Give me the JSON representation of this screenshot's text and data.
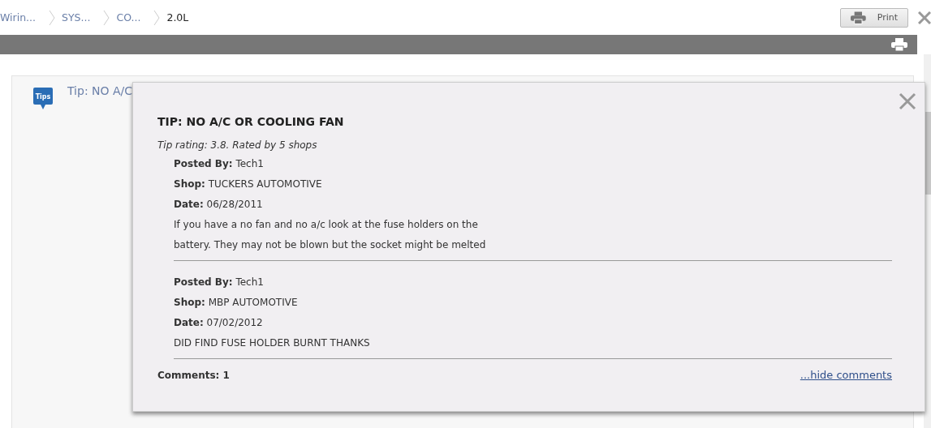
{
  "breadcrumbs": [
    {
      "label": "Wirin...",
      "current": false
    },
    {
      "label": "SYS...",
      "current": false
    },
    {
      "label": "CO...",
      "current": false
    },
    {
      "label": "2.0L",
      "current": true
    }
  ],
  "print_button": {
    "label": "Print"
  },
  "tip_card": {
    "badge": "Tips",
    "link": "Tip: NO A/C"
  },
  "popup": {
    "title": "TIP: NO A/C OR COOLING FAN",
    "rating": "Tip rating: 3.8. Rated by 5 shops",
    "posts": [
      {
        "posted_by": "**Posted By:** Tech1",
        "shop": "**Shop:** TUCKERS AUTOMOTIVE",
        "date": "**Date:** 06/28/2011",
        "text": "If you have a no fan and no a/c look at the fuse holders on the battery. They may not be blown but the socket might be melted"
      },
      {
        "posted_by": "**Posted By:** Tech1",
        "shop": "**Shop:** MBP AUTOMOTIVE",
        "date": "**Date:** 07/02/2012",
        "text": "DID FIND FUSE HOLDER BURNT THANKS"
      }
    ],
    "comments": "Comments: 1",
    "hide_link": "...hide comments"
  }
}
